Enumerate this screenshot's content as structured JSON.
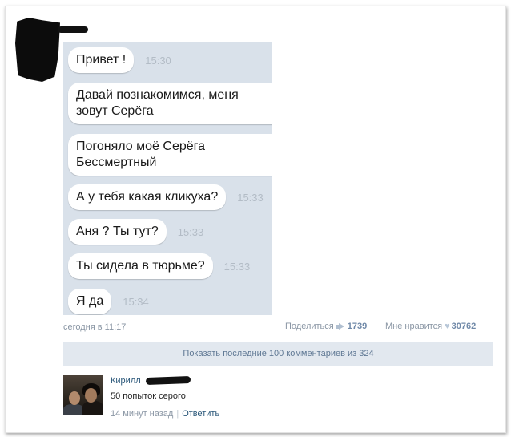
{
  "chat": {
    "messages": [
      {
        "text": "Привет !",
        "time": "15:30"
      },
      {
        "text": "Давай познакомимся, меня зовут Серёга",
        "time": ""
      },
      {
        "text": "Погоняло моё Серёга Бессмертный",
        "time": ""
      },
      {
        "text": "А у тебя какая кликуха?",
        "time": "15:33"
      },
      {
        "text": "Аня ? Ты тут?",
        "time": "15:33"
      },
      {
        "text": "Ты сидела в тюрьме?",
        "time": "15:33"
      },
      {
        "text": "Я да",
        "time": "15:34"
      }
    ]
  },
  "post": {
    "date": "сегодня в 11:17",
    "share_label": "Поделиться",
    "share_count": "1739",
    "like_label": "Мне нравится",
    "like_count": "30762",
    "share_icon": "megaphone-icon",
    "like_icon": "heart-icon"
  },
  "comments": {
    "show_more_label": "Показать последние 100 комментариев из 324",
    "items": [
      {
        "author": "Кирилл",
        "text": "50 попыток серого",
        "time": "14 минут назад",
        "separator": "|",
        "reply_label": "Ответить"
      }
    ]
  },
  "colors": {
    "chat_background": "#d9e1ea",
    "bubble": "#ffffff",
    "link": "#2b587a",
    "meta": "#8b97a5",
    "show_more_bg": "#e2e8ef"
  }
}
